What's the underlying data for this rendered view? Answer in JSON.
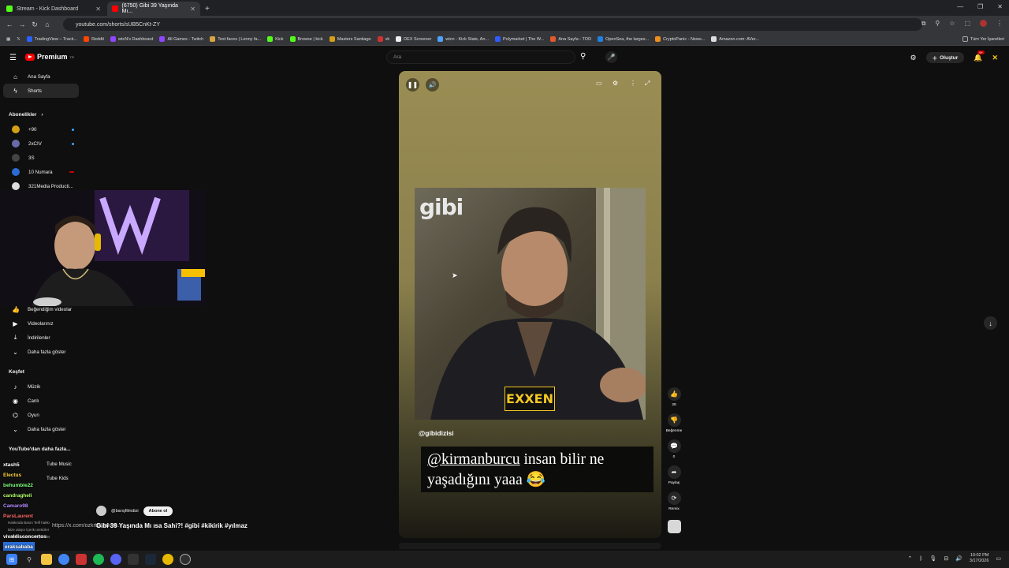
{
  "browser": {
    "tabs": [
      {
        "title": "Stream - Kick Dashboard",
        "active": false
      },
      {
        "title": "(6750) Gibi 39 Yaşında Mı...",
        "active": true
      }
    ],
    "url": "youtube.com/shorts/sUB5CnKt-ZY",
    "bookmarks": [
      "TradingView – Track...",
      "Reddit",
      "wtcN's Dashboard",
      "All Games - Twitch",
      "Text faces | Lenny fa...",
      "Kick",
      "Browse | kick",
      "Masters Santiago",
      "vk",
      "DEX Screener",
      "wtcn - Kick Stats, An...",
      "Polymarket | The W...",
      "Ana Sayfa - TOD",
      "OpenSea, the larges...",
      "CryptoPanic - News...",
      "Amazon.com: AVer...",
      "Tüm Yer İşaretleri"
    ]
  },
  "header": {
    "logo_text": "Premium",
    "logo_sup": "TR",
    "search_placeholder": "Ara",
    "create_label": "Oluştur",
    "notification_count": "9+"
  },
  "sidebar": {
    "main": [
      {
        "label": "Ana Sayfa",
        "icon": "home-icon"
      },
      {
        "label": "Shorts",
        "icon": "shorts-icon",
        "active": true
      }
    ],
    "subs_header": "Abonelikler",
    "subs": [
      {
        "label": "+90",
        "color": "#d4a017"
      },
      {
        "label": "2xCIV",
        "color": "#6a6aa8"
      },
      {
        "label": "3S",
        "color": "#444"
      },
      {
        "label": "10 Numara",
        "color": "#2b6cd4"
      },
      {
        "label": "321Media Producti...",
        "color": "#ddd"
      }
    ],
    "you": [
      {
        "label": "Beğendiğim videolar",
        "icon": "thumbs-up-icon"
      },
      {
        "label": "Videolarınız",
        "icon": "video-icon"
      },
      {
        "label": "İndirilenler",
        "icon": "download-icon"
      },
      {
        "label": "Daha fazla göster",
        "icon": "chevron-down-icon"
      }
    ],
    "explore_header": "Keşfet",
    "explore": [
      {
        "label": "Müzik",
        "icon": "music-icon"
      },
      {
        "label": "Canlı",
        "icon": "live-icon"
      },
      {
        "label": "Oyun",
        "icon": "gaming-icon"
      },
      {
        "label": "Daha fazla göster",
        "icon": "chevron-down-icon"
      }
    ],
    "more_header": "YouTube'dan daha fazla...",
    "more": [
      "Tube Music",
      "Tube Kids"
    ],
    "footer": [
      "Hakkında  Basın  Telif hakkı",
      "Bize ulaşın  İçerik üreticiler",
      "Reklam verme  Geliştiriciler"
    ]
  },
  "chat": [
    {
      "user": "xtash5",
      "color": "#ffffff"
    },
    {
      "user": "Electus",
      "color": "#ffd23f"
    },
    {
      "user": "behumble22",
      "color": "#7dff7d"
    },
    {
      "user": "candragheli",
      "color": "#b0ff6a"
    },
    {
      "user": "Camaro98",
      "color": "#b48cff"
    },
    {
      "user": "ParsLaurent",
      "color": "#ff6b6b"
    },
    {
      "user": "vivaldisconcertos",
      "color": "#ffffff"
    },
    {
      "user": "eraksababa",
      "color": "#ffffff"
    }
  ],
  "short": {
    "handle": "@gibidizisi",
    "caption_mention": "@kirmanburcu",
    "caption_rest": " insan bilir ne yaşadığını yaaa 😂",
    "logo_text": "gibi",
    "watermark": "EXXEN",
    "likes": "28",
    "dislike_label": "Beğenme",
    "comments": "0",
    "share_label": "Paylaş",
    "remix_label": "Remix"
  },
  "next": {
    "channel": "@barışfilmdizi",
    "subscribe_label": "Abone ol",
    "title": "Gibi 39 Yaşında Mı ısa Sahi?! #gibi #kikirik #yılmaz",
    "overlay_url": "https://x.com/ozkrtburak/st..."
  },
  "taskbar": {
    "time": "10:02 PM",
    "date": "3/17/2026"
  }
}
